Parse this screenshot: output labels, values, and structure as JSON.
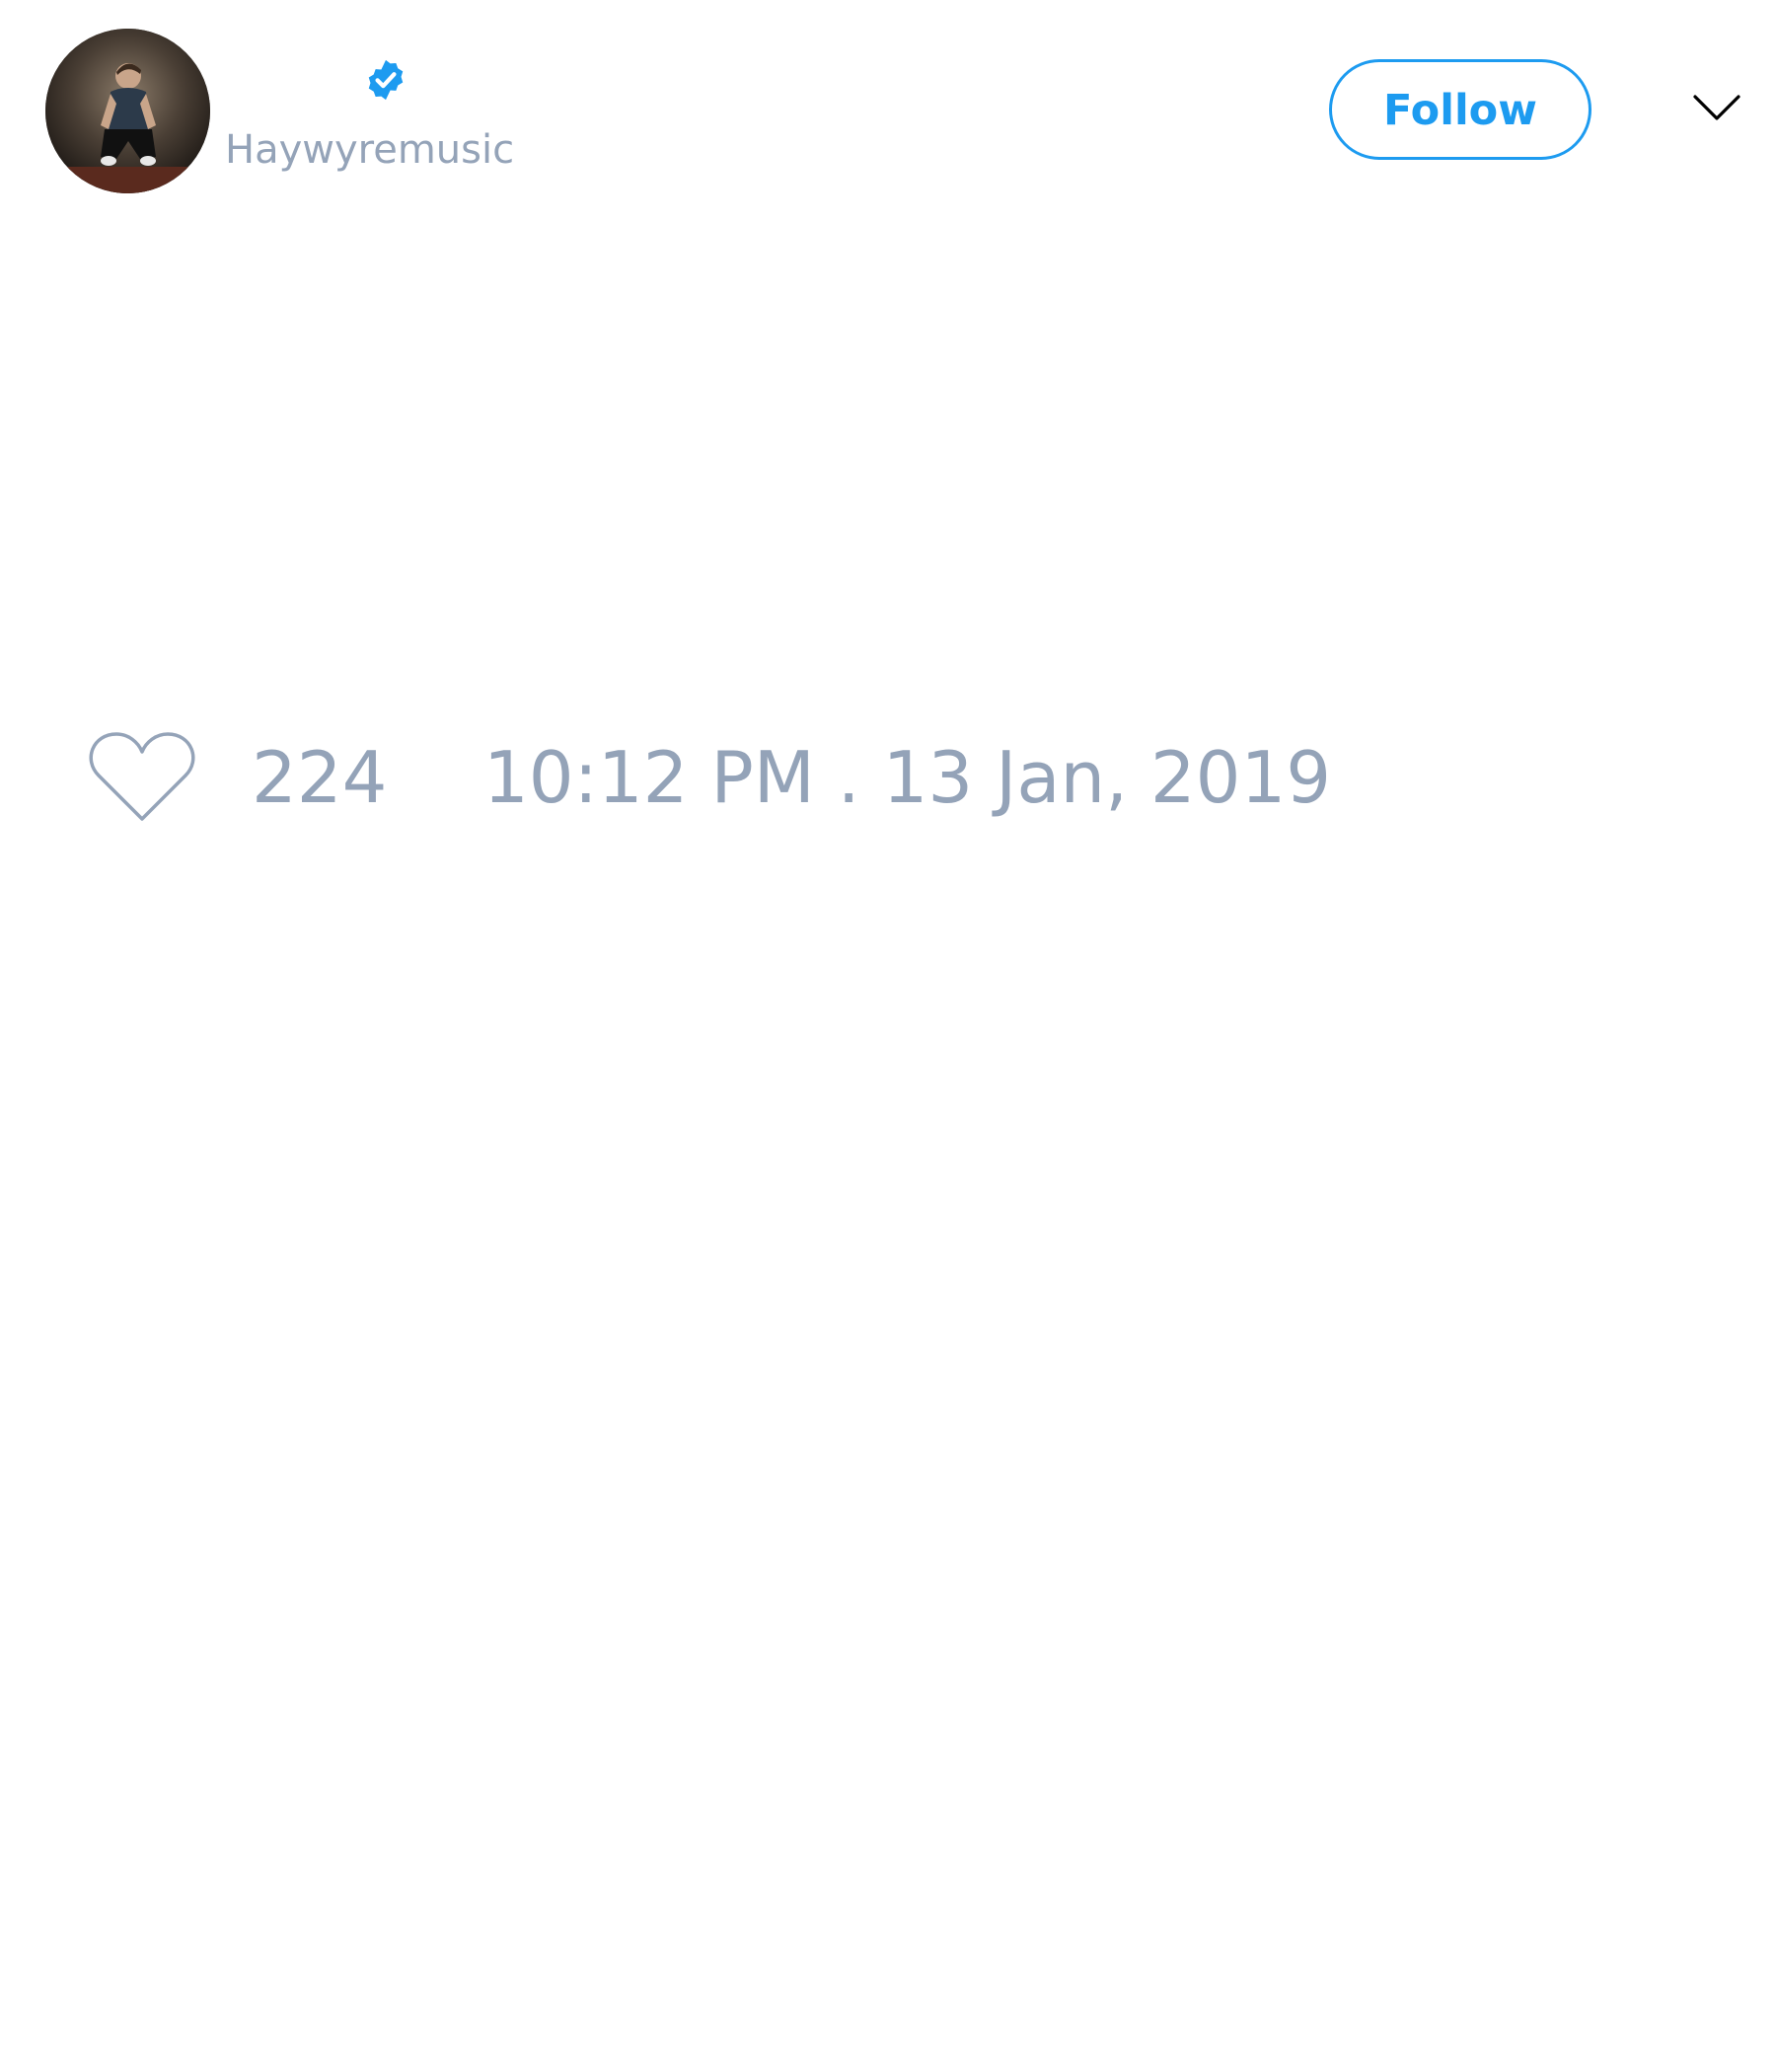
{
  "author": {
    "handle": "Haywyremusic",
    "verified": true,
    "avatar_icon": "user-avatar-photo"
  },
  "header": {
    "follow_label": "Follow",
    "more_icon": "chevron-down-icon"
  },
  "footer": {
    "like_icon": "heart-outline-icon",
    "like_count": "224",
    "timestamp": "10:12 PM . 13 Jan, 2019"
  },
  "colors": {
    "accent": "#1d9bf0",
    "muted_text": "#94a3b8",
    "background": "#ffffff"
  }
}
